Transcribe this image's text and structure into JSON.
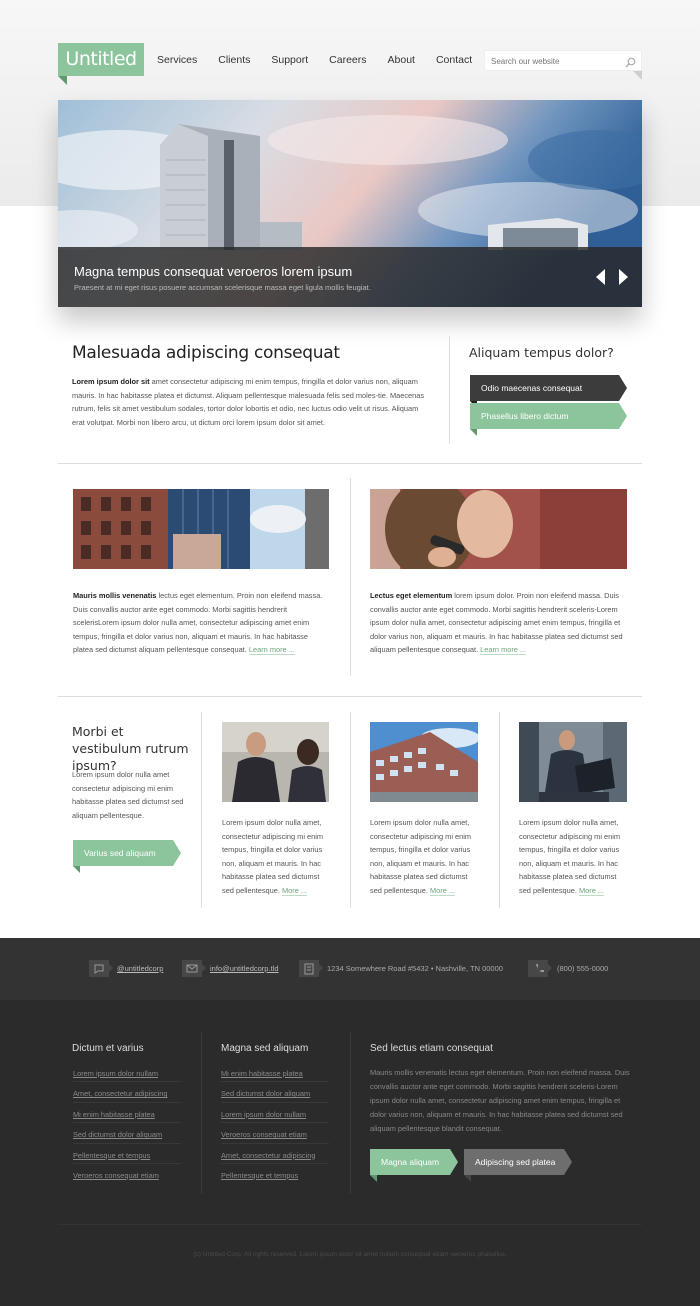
{
  "header": {
    "logo": "Untitled",
    "nav": [
      "Services",
      "Clients",
      "Support",
      "Careers",
      "About",
      "Contact"
    ],
    "search_placeholder": "Search our website"
  },
  "banner": {
    "title": "Magna tempus consequat veroeros lorem ipsum",
    "subtitle": "Praesent at mi eget risus posuere accumsan scelerisque massa eget ligula mollis feugiat."
  },
  "intro": {
    "heading": "Malesuada adipiscing consequat",
    "bold": "Lorem ipsum dolor sit",
    "text": " amet consectetur adipiscing mi enim tempus, fringilla et dolor varius non, aliquam mauris. In hac habitasse platea et dictumst. Aliquam pellentesque malesuada felis sed moles-tie. Maecenas rutrum, felis sit amet vestibulum sodales, tortor dolor lobortis et odio, nec luctus odio velit ut risus. Aliquam erat volutpat. Morbi non libero arcu, ut dictum orci lorem ipsum dolor sit amet."
  },
  "sidebar": {
    "heading": "Aliquam tempus dolor?",
    "items": [
      "Odio maecenas consequat",
      "Phasellus libero dictum"
    ]
  },
  "features": [
    {
      "bold": "Mauris mollis venenatis",
      "text": " lectus eget elementum. Proin non eleifend massa. Duis convallis auctor ante eget commodo. Morbi sagittis hendrerit scelerisLorem ipsum dolor nulla amet, consectetur adipiscing amet enim tempus, fringilla et dolor varius non, aliquam et mauris. In hac habitasse platea sed dictumst aliquam pellentesque consequat.",
      "more": "Learn more ..."
    },
    {
      "bold": "Lectus eget elementum",
      "text": " lorem ipsum dolor. Proin non eleifend massa. Duis convallis auctor ante eget commodo. Morbi sagittis hendrerit sceleris-Lorem ipsum dolor nulla amet, consectetur adipiscing amet enim tempus, fringilla et dolor varius non, aliquam et mauris. In hac habitasse platea sed dictumst sed  aliquam pellentesque consequat.",
      "more": "Learn more ..."
    }
  ],
  "promo": {
    "heading": "Morbi et vestibulum rutrum ipsum?",
    "text": "Lorem ipsum dolor nulla amet consectetur adipiscing mi enim habitasse platea sed dictumst sed  aliquam pellentesque.",
    "button": "Varius sed aliquam"
  },
  "thumbs": [
    {
      "text": "Lorem ipsum dolor nulla amet, consectetur adipiscing mi enim tempus, fringilla et dolor varius non, aliquam et mauris. In hac habitasse platea sed dictumst sed pellentesque.",
      "more": "More ..."
    },
    {
      "text": "Lorem ipsum dolor nulla amet, consectetur adipiscing mi enim tempus, fringilla et dolor varius non, aliquam et mauris. In hac habitasse platea sed dictumst sed pellentesque.",
      "more": "More ..."
    },
    {
      "text": "Lorem ipsum dolor nulla amet, consectetur adipiscing mi enim tempus, fringilla et dolor varius non, aliquam et mauris. In hac habitasse platea sed dictumst sed pellentesque.",
      "more": "More ..."
    }
  ],
  "contact": {
    "twitter": "@untitledcorp",
    "email": "info@untitledcorp.tld",
    "address": "1234 Somewhere Road  #5432 •  Nashville, TN 00000",
    "phone": "(800) 555-0000"
  },
  "footer": {
    "col1": {
      "heading": "Dictum et varius",
      "links": [
        "Lorem ipsum dolor nullam",
        "Amet, consectetur adipiscing",
        "Mi enim habitasse platea",
        "Sed dictumst dolor aliquam",
        "Pellentesque et tempus",
        "Veroeros consequat etiam"
      ]
    },
    "col2": {
      "heading": "Magna sed aliquam",
      "links": [
        "Mi enim habitasse platea",
        "Sed dictumst dolor aliquam",
        "Lorem ipsum dolor nullam",
        "Veroeros consequat etiam",
        "Amet, consectetur adipiscing",
        "Pellentesque et tempus"
      ]
    },
    "col3": {
      "heading": "Sed lectus etiam consequat",
      "text": "Mauris mollis venenatis lectus eget elementum. Proin non eleifend massa. Duis convallis auctor ante eget commodo. Morbi sagittis hendrerit sceleris-Lorem ipsum dolor nulla amet, consectetur adipiscing amet enim tempus, fringilla et dolor varius non, aliquam et mauris. In hac habitasse platea sed dictumst sed  aliquam pellentesque blandit consequat.",
      "button1": "Magna aliquam",
      "button2": "Adipiscing sed platea"
    },
    "copyright": "(c) Untitled Corp. All rights reserved. Lorem ipsum dolor sit amet nullam consequat etiam veroeros phasellus."
  },
  "colors": {
    "accent": "#8cc49c",
    "dark": "#3c3c3c",
    "footer": "#2b2b2b"
  },
  "icons": [
    "search-icon",
    "prev-arrow-icon",
    "next-arrow-icon",
    "chat-icon",
    "mail-icon",
    "document-icon",
    "phone-icon"
  ]
}
